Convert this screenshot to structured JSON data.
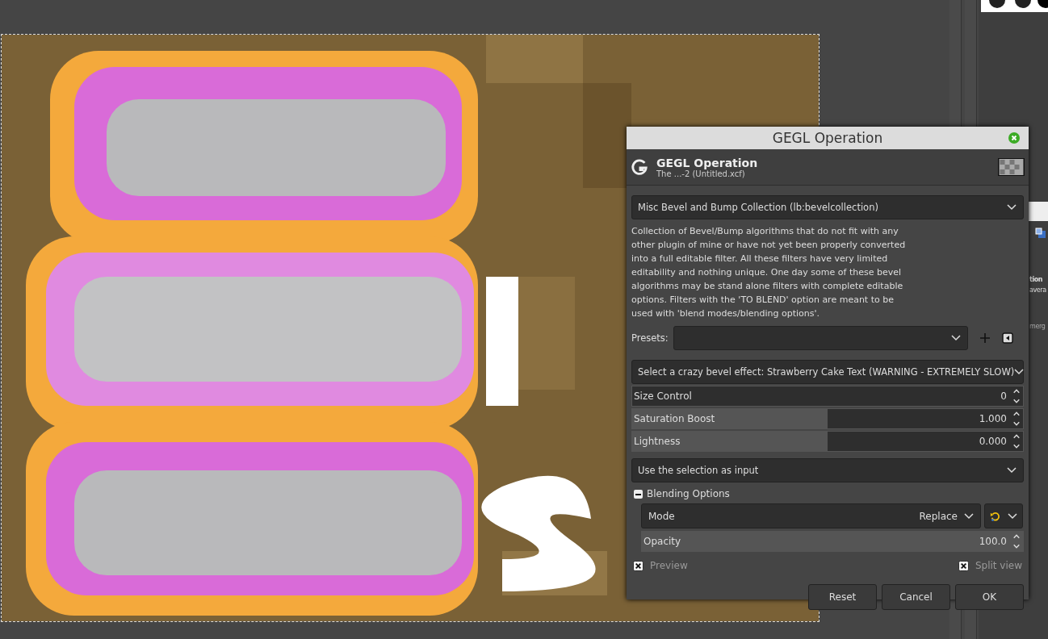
{
  "side_panel": {
    "texts": [
      "tion",
      "avera",
      "merg"
    ]
  },
  "dialog": {
    "title": "GEGL Operation",
    "header": {
      "title": "GEGL Operation",
      "subtitle": "The  ...-2 (Untitled.xcf)"
    },
    "operation": {
      "value": "Misc Bevel and Bump Collection (lb:bevelcollection)"
    },
    "description": "Collection of Bevel/Bump algorithms that do not fit with any other plugin of mine or have not yet been properly converted into a full editable filter. All these filters have very limited editability and nothing unique. One day some of these bevel algorithms may be stand alone filters with complete editable options. Filters with the 'TO BLEND' option are meant to be used with 'blend modes/blending options'.",
    "presets": {
      "label": "Presets:"
    },
    "effect": {
      "value": "Select a crazy bevel effect: Strawberry Cake Text (WARNING - EXTREMELY SLOW)"
    },
    "sliders": [
      {
        "label": "Size Control",
        "value": "0",
        "level": 0
      },
      {
        "label": "Saturation Boost",
        "value": "1.000",
        "level": 0.5
      },
      {
        "label": "Lightness",
        "value": "0.000",
        "level": 0.5
      }
    ],
    "input": {
      "value": "Use the selection as input"
    },
    "blending": {
      "label": "Blending Options",
      "expanded": true,
      "mode": {
        "label": "Mode",
        "value": "Replace"
      },
      "opacity": {
        "label": "Opacity",
        "value": "100.0",
        "level": 1
      }
    },
    "checkboxes": [
      {
        "label": "Preview",
        "checked": true
      },
      {
        "label": "Split view",
        "checked": true
      }
    ],
    "buttons": [
      "Reset",
      "Cancel",
      "OK"
    ]
  }
}
